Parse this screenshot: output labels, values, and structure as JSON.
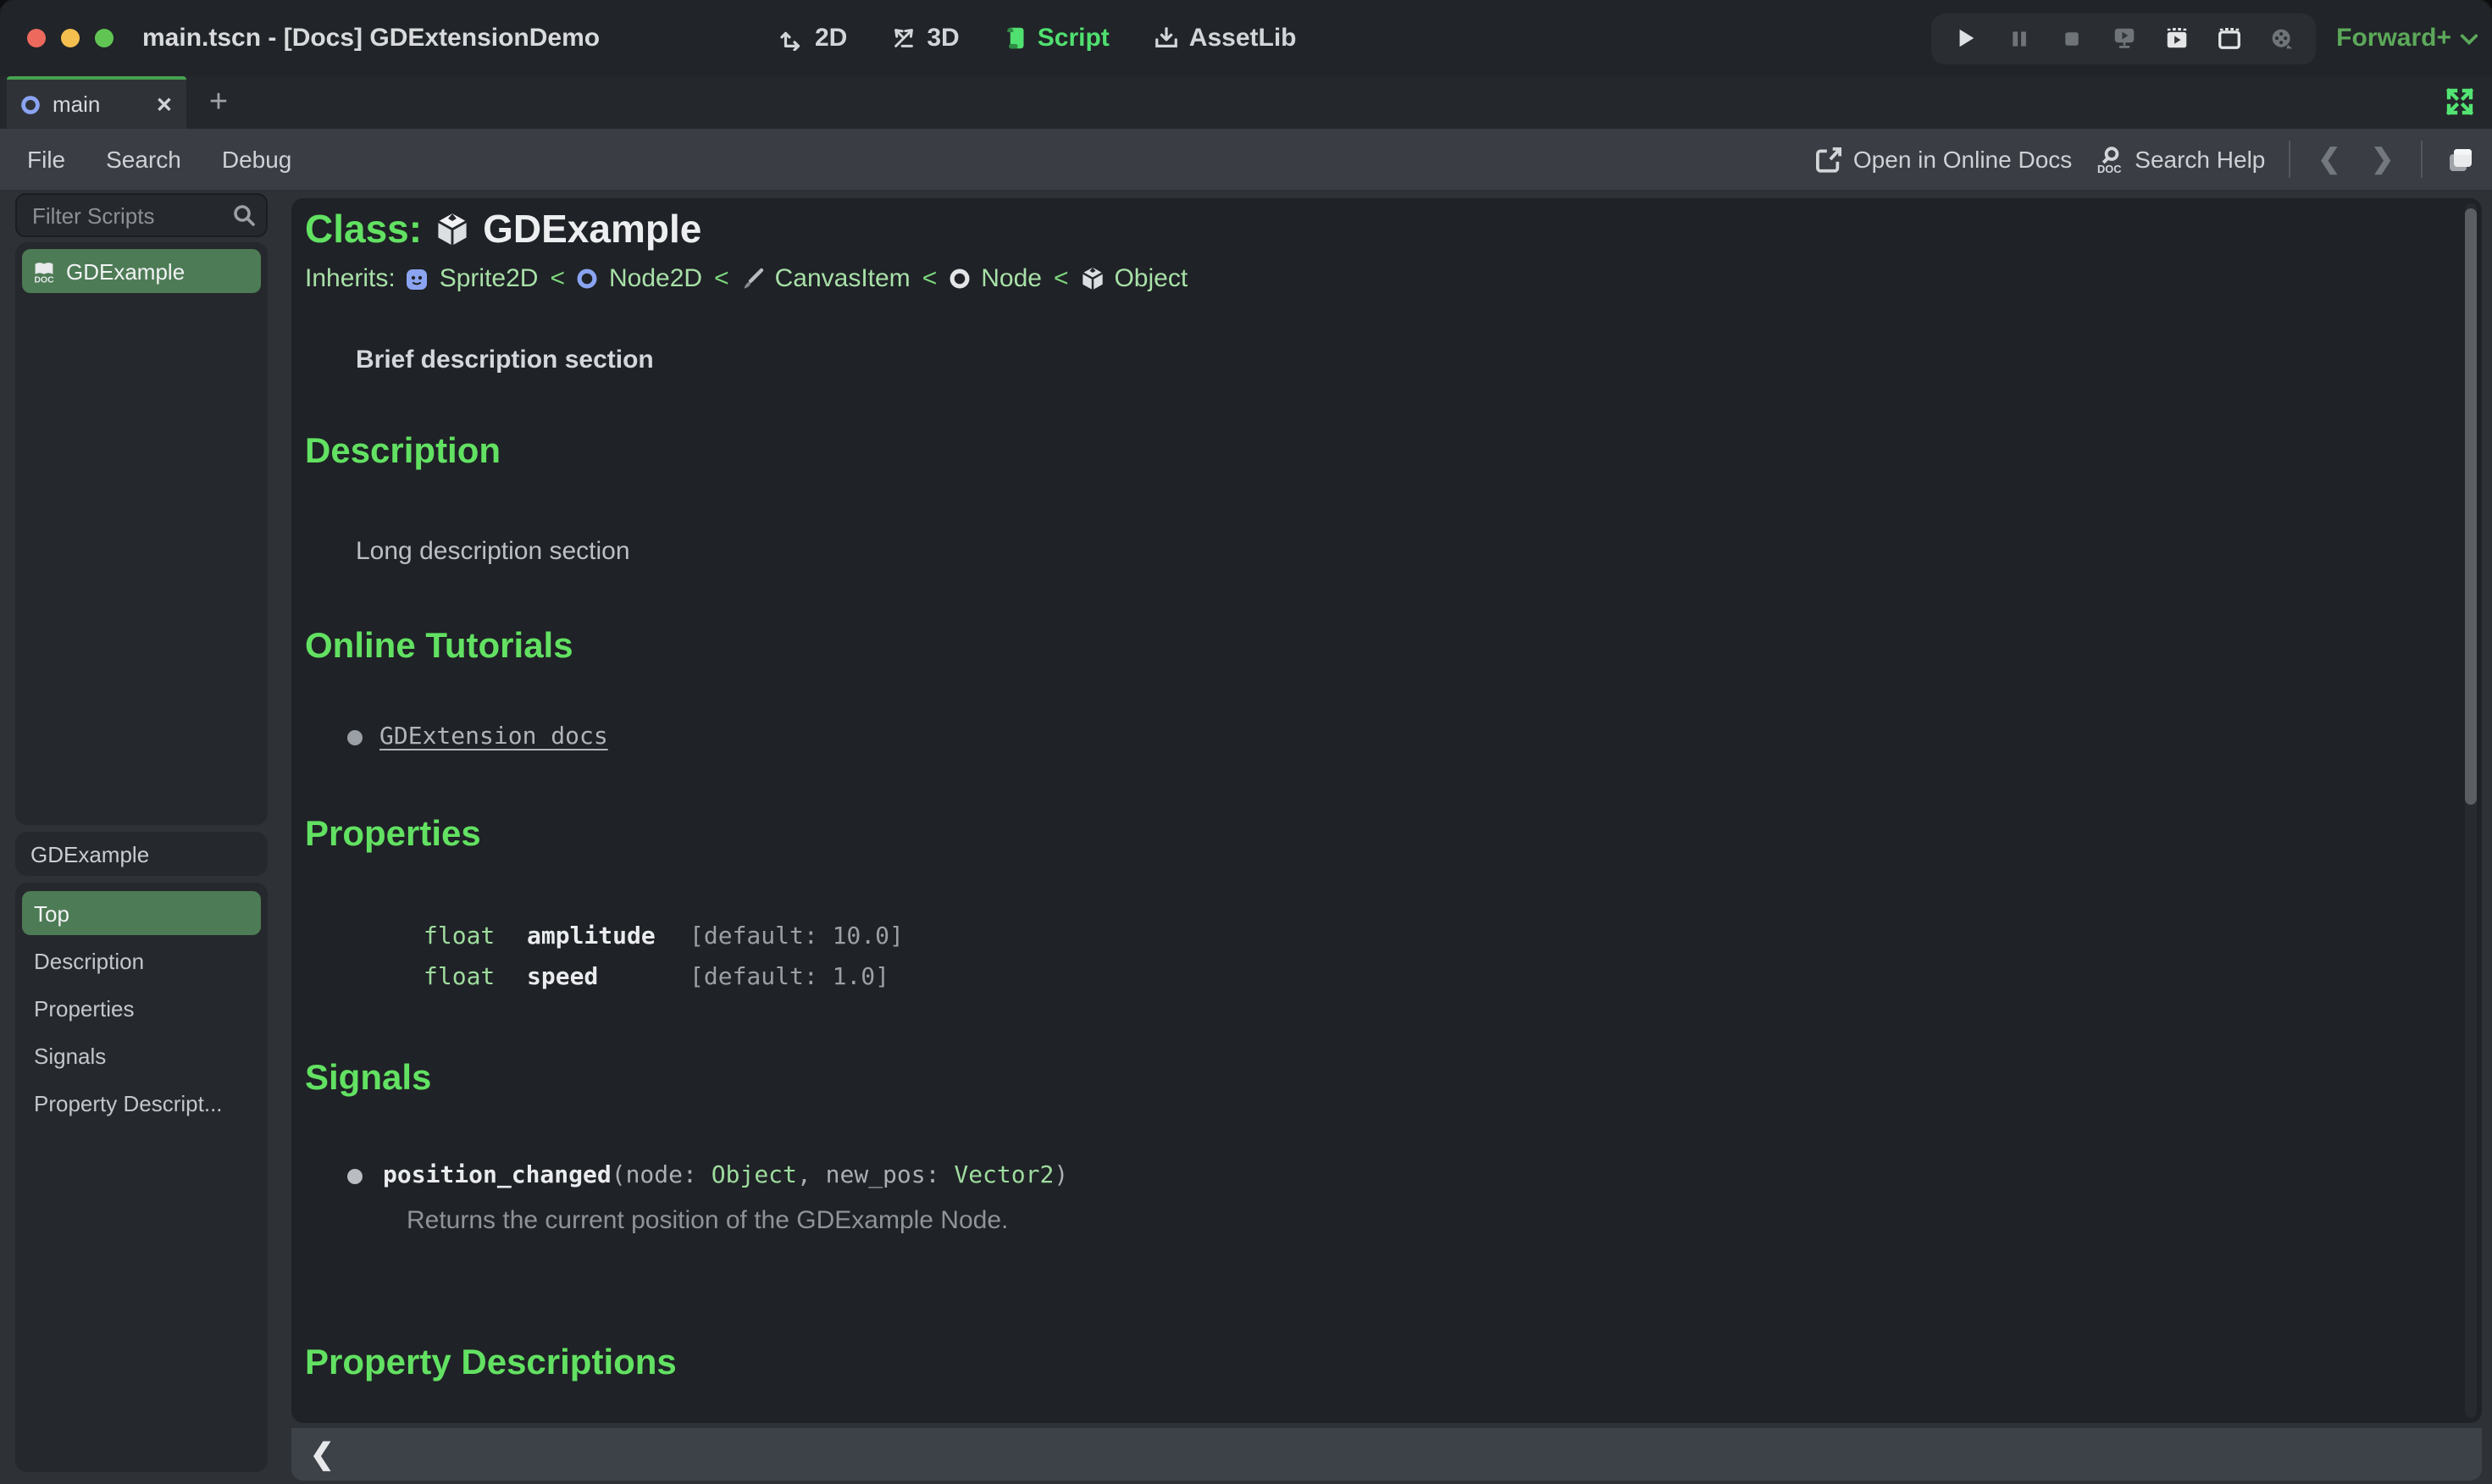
{
  "colors": {
    "accent_green": "#62e162",
    "link_green": "#a8e0a8",
    "type_green": "#9edc9e",
    "selected_green": "#4d7b55",
    "script_tab_green": "#50e070",
    "renderer_green": "#5ca95a",
    "node_blue": "#8ba4f2",
    "traffic_red": "#ed695e",
    "traffic_yellow": "#f4bf4f",
    "traffic_green": "#61c554"
  },
  "titlebar": {
    "title": "main.tscn - [Docs] GDExtensionDemo",
    "nav": {
      "n0": "2D",
      "n1": "3D",
      "n2": "Script",
      "n3": "AssetLib"
    },
    "renderer": "Forward+"
  },
  "tabbar": {
    "tab": "main",
    "close": "✕",
    "add": "+"
  },
  "menubar": {
    "file": "File",
    "search": "Search",
    "debug": "Debug",
    "open_online": "Open in Online Docs",
    "search_help": "Search Help",
    "back": "❮",
    "forward": "❯"
  },
  "sidebar": {
    "filter_placeholder": "Filter Scripts",
    "script_item": "GDExample",
    "members_header": "GDExample",
    "members": [
      "Top",
      "Description",
      "Properties",
      "Signals",
      "Property Descript..."
    ]
  },
  "doc": {
    "class_label": "Class:",
    "class_name": "GDExample",
    "inherits_label": "Inherits:",
    "sep": "<",
    "chain": [
      "Sprite2D",
      "Node2D",
      "CanvasItem",
      "Node",
      "Object"
    ],
    "brief": "Brief description section",
    "h_description": "Description",
    "long_description": "Long description section",
    "h_tutorials": "Online Tutorials",
    "tutorial_link": "GDExtension docs",
    "h_properties": "Properties",
    "properties": [
      {
        "type": "float",
        "name": "amplitude",
        "default": "[default: 10.0]"
      },
      {
        "type": "float",
        "name": "speed",
        "default": "[default: 1.0]"
      }
    ],
    "h_signals": "Signals",
    "signal": {
      "name": "position_changed",
      "open": "(node: ",
      "type1": "Object",
      "mid": ", new_pos: ",
      "type2": "Vector2",
      "close": ")",
      "description": "Returns the current position of the GDExample Node."
    },
    "h_prop_desc": "Property Descriptions",
    "collapse": "❮"
  }
}
